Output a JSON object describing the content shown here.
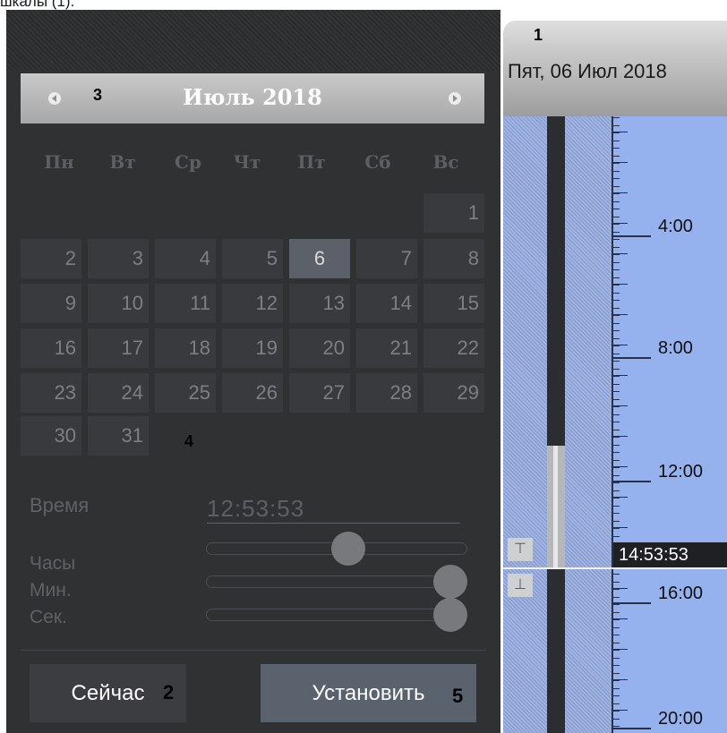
{
  "caption": "шкалы (1).",
  "calendar": {
    "month_title": "Июль 2018",
    "weekdays": [
      "Пн",
      "Вт",
      "Ср",
      "Чт",
      "Пт",
      "Сб",
      "Вс"
    ],
    "days": [
      "1",
      "2",
      "3",
      "4",
      "5",
      "6",
      "7",
      "8",
      "9",
      "10",
      "11",
      "12",
      "13",
      "14",
      "15",
      "16",
      "17",
      "18",
      "19",
      "20",
      "21",
      "22",
      "23",
      "24",
      "25",
      "26",
      "27",
      "28",
      "29",
      "30",
      "31"
    ],
    "selected_day": "6"
  },
  "time": {
    "label": "Время",
    "value": "12:53:53",
    "hours_label": "Часы",
    "minutes_label": "Мин.",
    "seconds_label": "Сек.",
    "hours_level": 0.55,
    "minutes_level": 1.0,
    "seconds_level": 1.0
  },
  "buttons": {
    "now": "Сейчас",
    "set": "Установить"
  },
  "markers": {
    "m1": "1",
    "m2": "2",
    "m3": "3",
    "m4": "4",
    "m5": "5"
  },
  "timeline": {
    "date": "Пят, 06 Июл 2018",
    "hours": [
      "4:00",
      "8:00",
      "12:00",
      "16:00",
      "20:00"
    ],
    "current_time": "14:53:53",
    "zoom_in_glyph": "⊤",
    "zoom_out_glyph": "⊥"
  }
}
